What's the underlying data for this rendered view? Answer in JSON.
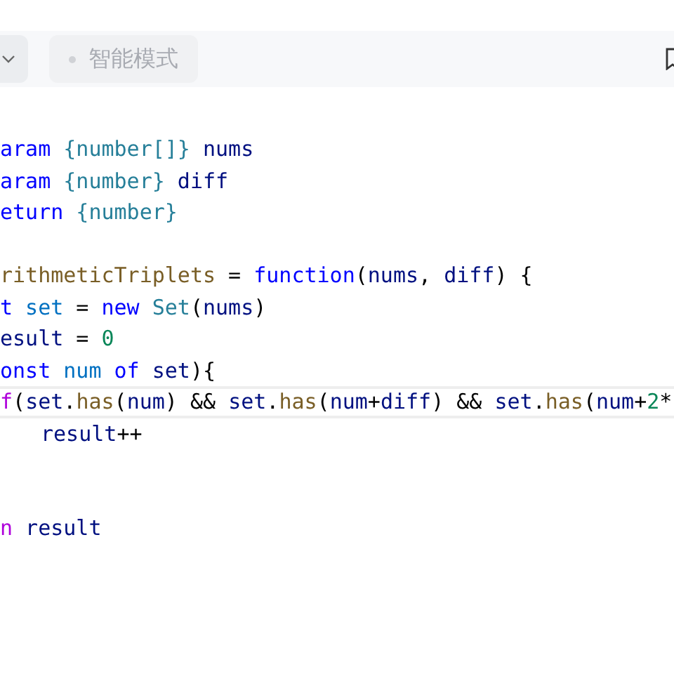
{
  "toolbar": {
    "mode_button": {
      "label": "智能模式"
    }
  },
  "code_lines": [
    {
      "current": false,
      "tokens": [
        {
          "kind": "keyword",
          "text": "aram"
        },
        {
          "kind": "type",
          "text": " {number[]}"
        },
        {
          "kind": "variable",
          "text": " nums"
        }
      ]
    },
    {
      "current": false,
      "tokens": [
        {
          "kind": "keyword",
          "text": "aram"
        },
        {
          "kind": "type",
          "text": " {number}"
        },
        {
          "kind": "variable",
          "text": " diff"
        }
      ]
    },
    {
      "current": false,
      "tokens": [
        {
          "kind": "keyword",
          "text": "eturn"
        },
        {
          "kind": "type",
          "text": " {number}"
        }
      ]
    },
    {
      "current": false
    },
    {
      "current": false,
      "tokens": [
        {
          "kind": "function",
          "text": "rithmeticTriplets"
        },
        {
          "kind": "plain",
          "text": " = "
        },
        {
          "kind": "keyword",
          "text": "function"
        },
        {
          "kind": "plain",
          "text": "("
        },
        {
          "kind": "variable",
          "text": "nums"
        },
        {
          "kind": "plain",
          "text": ", "
        },
        {
          "kind": "variable",
          "text": "diff"
        },
        {
          "kind": "plain",
          "text": ") {"
        }
      ]
    },
    {
      "current": false,
      "tokens": [
        {
          "kind": "keyword",
          "text": "t"
        },
        {
          "kind": "constant",
          "text": " set"
        },
        {
          "kind": "plain",
          "text": " = "
        },
        {
          "kind": "keyword",
          "text": "new"
        },
        {
          "kind": "type",
          "text": " Set"
        },
        {
          "kind": "plain",
          "text": "("
        },
        {
          "kind": "variable",
          "text": "nums"
        },
        {
          "kind": "plain",
          "text": ")"
        }
      ]
    },
    {
      "current": false,
      "tokens": [
        {
          "kind": "variable",
          "text": "esult"
        },
        {
          "kind": "plain",
          "text": " = "
        },
        {
          "kind": "number",
          "text": "0"
        }
      ]
    },
    {
      "current": false,
      "tokens": [
        {
          "kind": "keyword",
          "text": "onst"
        },
        {
          "kind": "constant",
          "text": " num"
        },
        {
          "kind": "keyword",
          "text": " of"
        },
        {
          "kind": "variable",
          "text": " set"
        },
        {
          "kind": "plain",
          "text": "){"
        }
      ]
    },
    {
      "current": true,
      "tokens": [
        {
          "kind": "control",
          "text": "f"
        },
        {
          "kind": "plain",
          "text": "("
        },
        {
          "kind": "variable",
          "text": "set"
        },
        {
          "kind": "plain",
          "text": "."
        },
        {
          "kind": "function",
          "text": "has"
        },
        {
          "kind": "plain",
          "text": "("
        },
        {
          "kind": "variable",
          "text": "num"
        },
        {
          "kind": "plain",
          "text": ") && "
        },
        {
          "kind": "variable",
          "text": "set"
        },
        {
          "kind": "plain",
          "text": "."
        },
        {
          "kind": "function",
          "text": "has"
        },
        {
          "kind": "plain",
          "text": "("
        },
        {
          "kind": "variable",
          "text": "num"
        },
        {
          "kind": "plain",
          "text": "+"
        },
        {
          "kind": "variable",
          "text": "diff"
        },
        {
          "kind": "plain",
          "text": ") && "
        },
        {
          "kind": "variable",
          "text": "set"
        },
        {
          "kind": "plain",
          "text": "."
        },
        {
          "kind": "function",
          "text": "has"
        },
        {
          "kind": "plain",
          "text": "("
        },
        {
          "kind": "variable",
          "text": "num"
        },
        {
          "kind": "plain",
          "text": "+"
        },
        {
          "kind": "number",
          "text": "2"
        },
        {
          "kind": "plain",
          "text": "*"
        }
      ],
      "children": [
        {
          "current": false,
          "tokens": [
            {
              "kind": "variable",
              "text": "result"
            },
            {
              "kind": "plain",
              "text": "++"
            }
          ]
        }
      ]
    },
    {
      "current": false
    },
    {
      "current": false
    },
    {
      "current": false,
      "tokens": [
        {
          "kind": "control",
          "text": "n"
        },
        {
          "kind": "variable",
          "text": " result"
        }
      ]
    }
  ]
}
